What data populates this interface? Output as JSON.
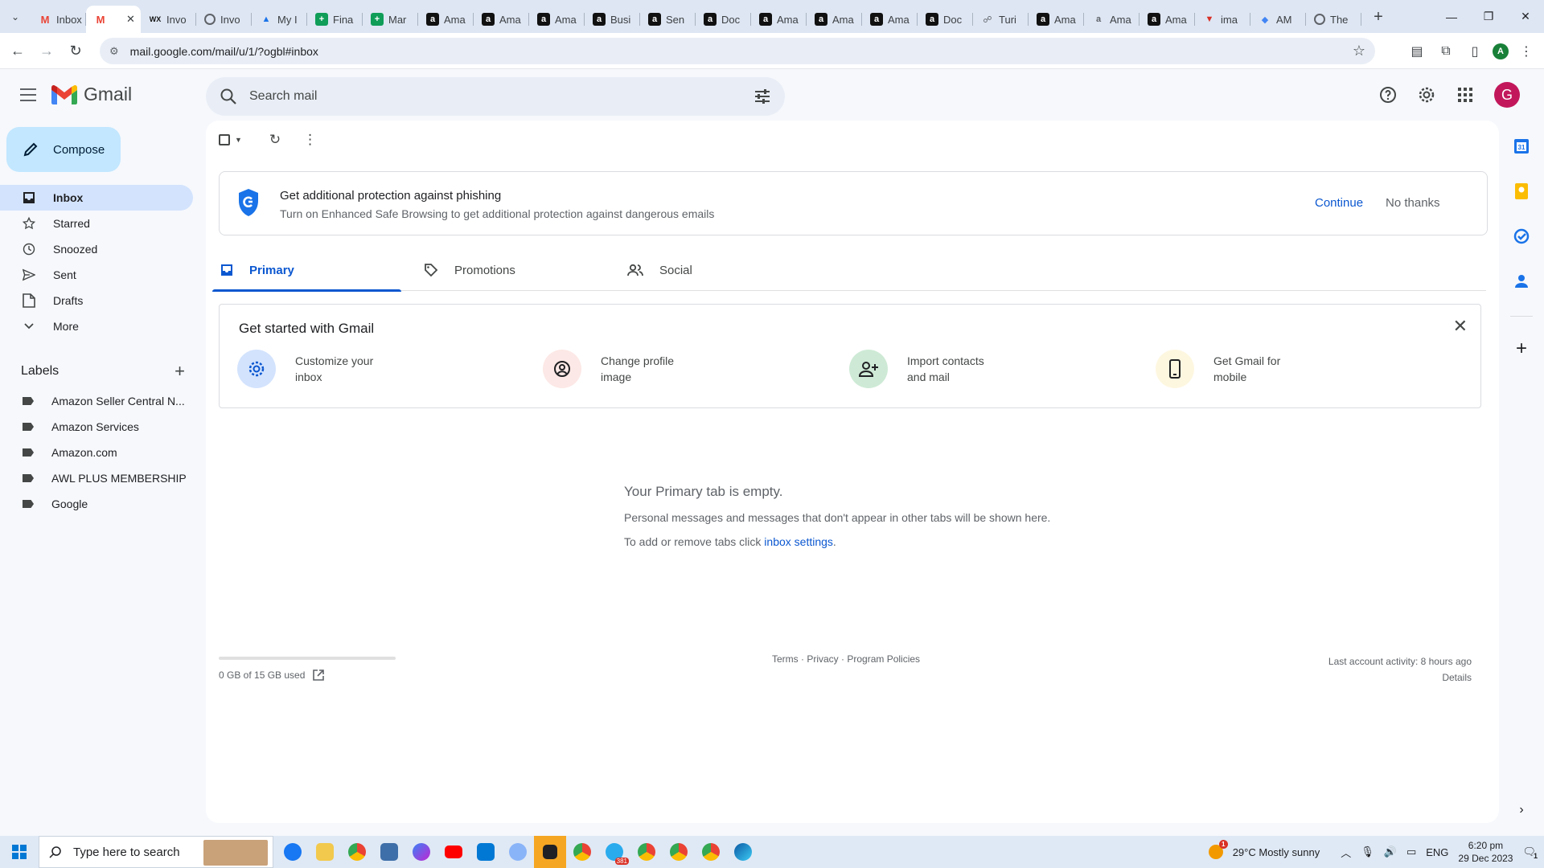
{
  "browser": {
    "tabs": [
      {
        "label": "Inbox",
        "icon": "gmail-icon"
      },
      {
        "label": "",
        "icon": "gmail-icon",
        "active": true
      },
      {
        "label": "Invo",
        "icon": "wix-icon"
      },
      {
        "label": "Invo",
        "icon": "globe-icon"
      },
      {
        "label": "My I",
        "icon": "drive-icon"
      },
      {
        "label": "Fina",
        "icon": "sheets-icon"
      },
      {
        "label": "Mar",
        "icon": "sheets-icon"
      },
      {
        "label": "Ama",
        "icon": "amazon-icon"
      },
      {
        "label": "Ama",
        "icon": "amazon-icon"
      },
      {
        "label": "Ama",
        "icon": "amazon-icon"
      },
      {
        "label": "Busi",
        "icon": "amazon-icon"
      },
      {
        "label": "Sen",
        "icon": "amazon-icon"
      },
      {
        "label": "Doc",
        "icon": "amazon-icon"
      },
      {
        "label": "Ama",
        "icon": "amazon-icon"
      },
      {
        "label": "Ama",
        "icon": "amazon-icon"
      },
      {
        "label": "Ama",
        "icon": "amazon-icon"
      },
      {
        "label": "Doc",
        "icon": "amazon-icon"
      },
      {
        "label": "Turi",
        "icon": "tune-icon"
      },
      {
        "label": "Ama",
        "icon": "amazon-icon"
      },
      {
        "label": "Ama",
        "icon": "amazon-smile-icon"
      },
      {
        "label": "Ama",
        "icon": "amazon-icon"
      },
      {
        "label": "ima",
        "icon": "red-v-icon"
      },
      {
        "label": "AM",
        "icon": "ai-icon"
      },
      {
        "label": "The",
        "icon": "globe-icon"
      }
    ],
    "url": "mail.google.com/mail/u/1/?ogbl#inbox",
    "profile_initial": "A"
  },
  "gmail": {
    "brand": "Gmail",
    "search_placeholder": "Search mail",
    "avatar_initial": "G",
    "compose_label": "Compose",
    "nav": [
      {
        "label": "Inbox",
        "icon": "inbox-icon",
        "active": true
      },
      {
        "label": "Starred",
        "icon": "star-icon"
      },
      {
        "label": "Snoozed",
        "icon": "clock-icon"
      },
      {
        "label": "Sent",
        "icon": "send-icon"
      },
      {
        "label": "Drafts",
        "icon": "draft-icon"
      },
      {
        "label": "More",
        "icon": "chevron-down-icon"
      }
    ],
    "labels_heading": "Labels",
    "labels": [
      "Amazon Seller Central N...",
      "Amazon Services",
      "Amazon.com",
      "AWL PLUS MEMBERSHIP",
      "Google"
    ],
    "banner": {
      "title": "Get additional protection against phishing",
      "subtitle": "Turn on Enhanced Safe Browsing to get additional protection against dangerous emails",
      "continue": "Continue",
      "no_thanks": "No thanks"
    },
    "tabs": [
      "Primary",
      "Promotions",
      "Social"
    ],
    "get_started": {
      "title": "Get started with Gmail",
      "items": [
        "Customize your inbox",
        "Change profile image",
        "Import contacts and mail",
        "Get Gmail for mobile"
      ]
    },
    "empty": {
      "title": "Your Primary tab is empty.",
      "line1": "Personal messages and messages that don't appear in other tabs will be shown here.",
      "line2_prefix": "To add or remove tabs click ",
      "line2_link": "inbox settings",
      "line2_suffix": "."
    },
    "footer": {
      "storage": "0 GB of 15 GB used",
      "storage_fraction": 0,
      "terms": "Terms",
      "privacy": "Privacy",
      "policies": "Program Policies",
      "sep": " · ",
      "last_activity": "Last account activity: 8 hours ago",
      "details": "Details"
    }
  },
  "taskbar": {
    "search_placeholder": "Type here to search",
    "weather": "29°C  Mostly sunny",
    "weather_badge": "1",
    "lang": "ENG",
    "time": "6:20 pm",
    "date": "29 Dec 2023",
    "notifications": "1",
    "telegram_badge": "381"
  },
  "colors": {
    "accent": "#0b57d0",
    "compose_bg": "#c2e7ff",
    "nav_active": "#d3e3fd",
    "avatar": "#c2185b"
  }
}
